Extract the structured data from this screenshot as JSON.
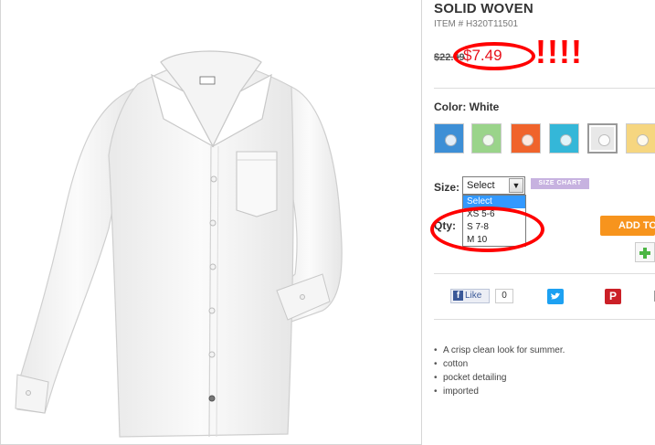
{
  "product": {
    "title": "SOLID WOVEN",
    "item_number": "ITEM # H320T11501",
    "original_price": "$22.99",
    "sale_price": "$7.49",
    "annotation": "!!!!",
    "colors": {
      "label": "Color: White",
      "swatches": [
        {
          "name": "blue",
          "color": "#3d8fd6"
        },
        {
          "name": "green",
          "color": "#9ad48a"
        },
        {
          "name": "orange",
          "color": "#f0632b"
        },
        {
          "name": "aqua",
          "color": "#34b7d8"
        },
        {
          "name": "white",
          "color": "#e8e8e8"
        },
        {
          "name": "yellow",
          "color": "#f6d680"
        }
      ]
    },
    "size": {
      "label": "Size:",
      "selected": "Select",
      "size_chart": "SIZE CHART",
      "options": [
        "Select",
        "XS 5-6",
        "S 7-8",
        "M 10"
      ]
    },
    "qty_label": "Qty:",
    "add_button": "ADD TO BAG",
    "social": {
      "like": "Like",
      "like_count": "0",
      "pinterest": "P"
    },
    "features": [
      "A crisp clean look for summer.",
      "cotton",
      "pocket detailing",
      "imported"
    ]
  },
  "colors": {
    "accent_red": "#ff0000",
    "price_red": "#e8101a",
    "add_orange": "#f7941d",
    "facebook": "#3b5998",
    "twitter": "#1da1f2",
    "pinterest": "#cb2027"
  }
}
